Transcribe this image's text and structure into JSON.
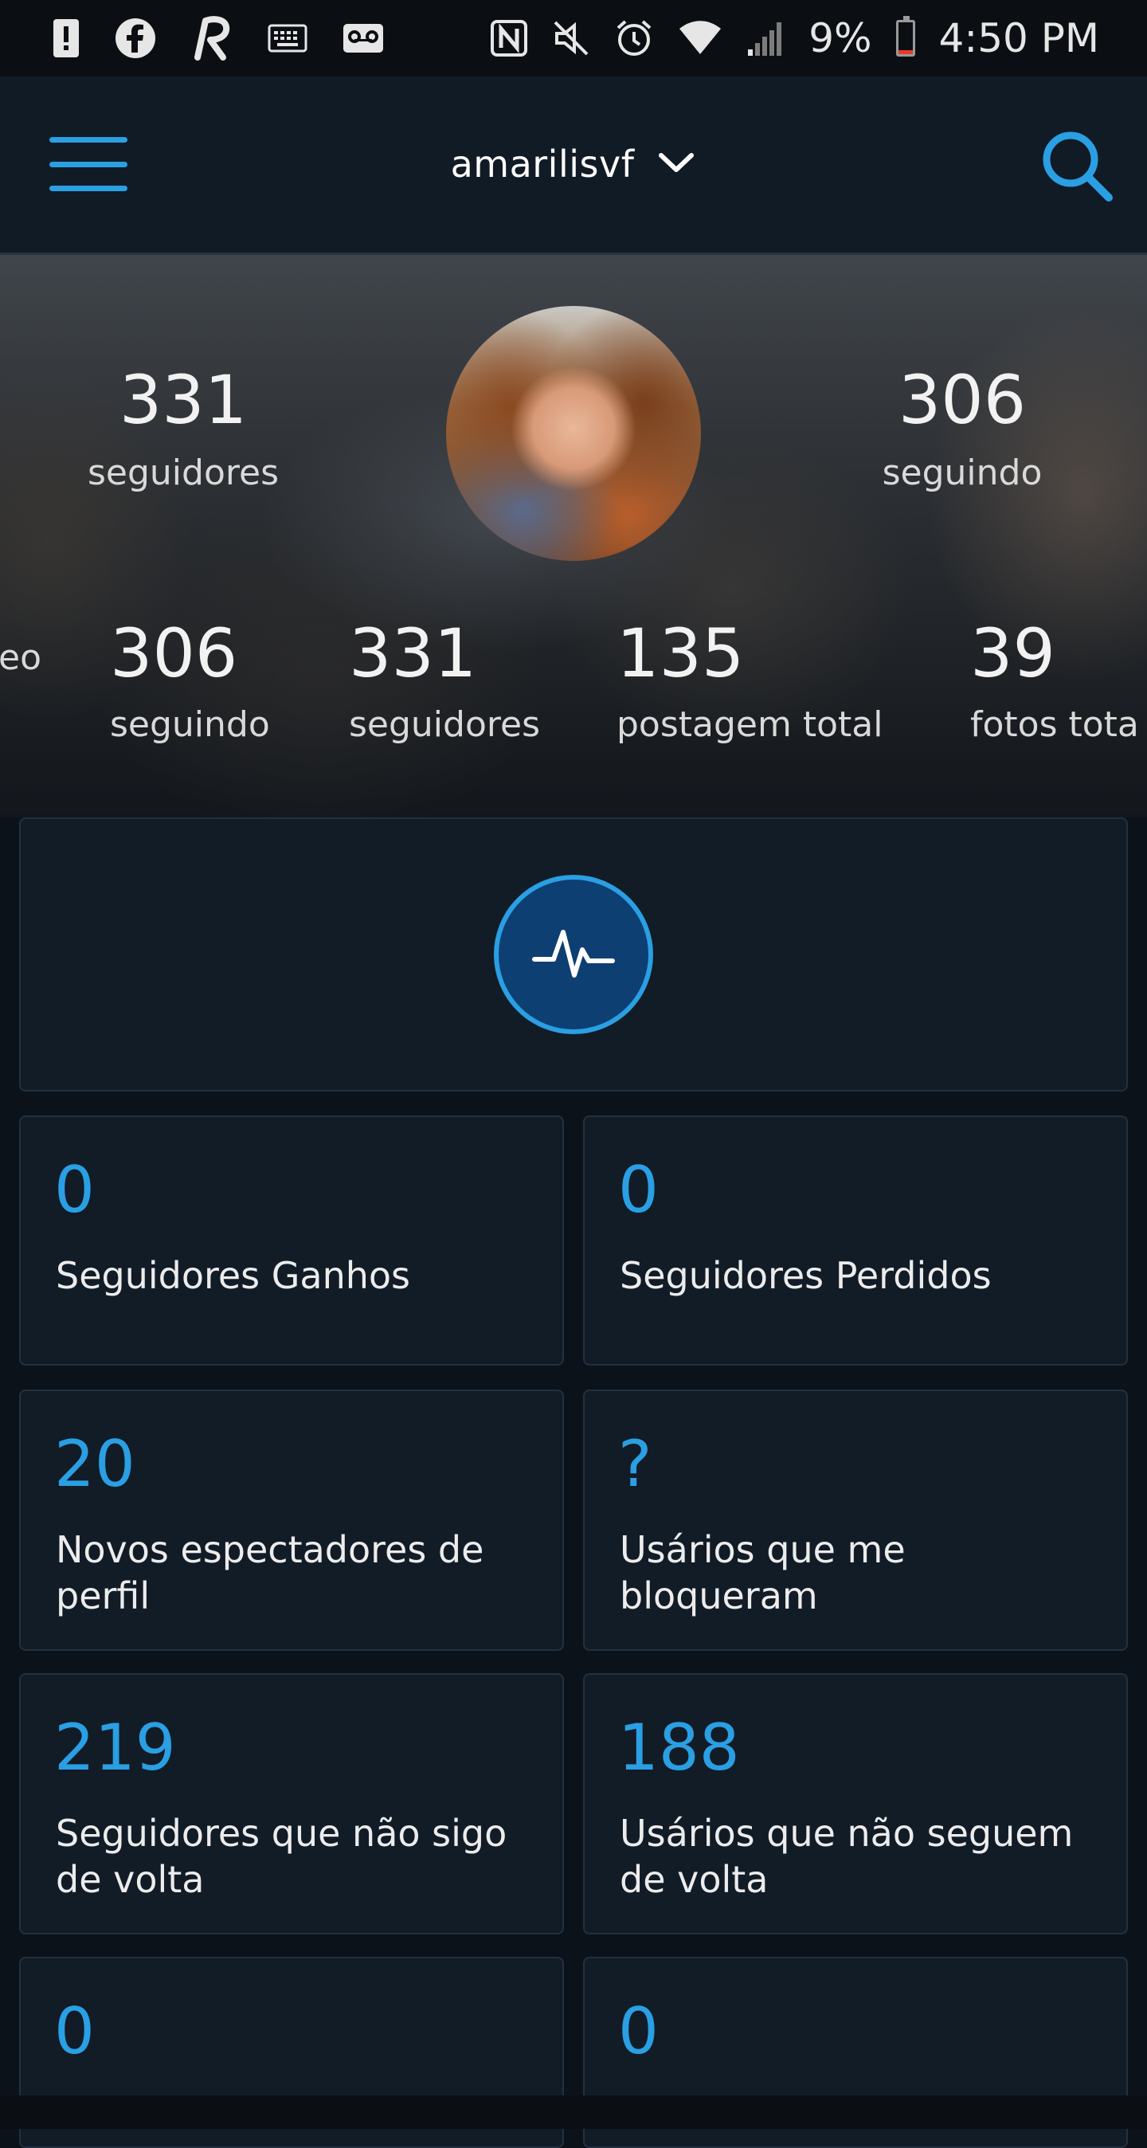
{
  "status_bar": {
    "battery_percent": "9%",
    "time": "4:50 PM",
    "battery_level": 0.09,
    "battery_fill_color": "#e53d2b",
    "left_icons": [
      "sim-alert-icon",
      "facebook-icon",
      "r-app-icon",
      "keyboard-icon",
      "voicemail-icon"
    ],
    "right_icons": [
      "nfc-icon",
      "mute-icon",
      "alarm-icon",
      "wifi-icon",
      "signal-icon",
      "battery-icon"
    ]
  },
  "header": {
    "account_name": "amarilisvf",
    "menu_icon": "hamburger-menu-icon",
    "dropdown_icon": "chevron-down-icon",
    "search_icon": "search-icon"
  },
  "profile": {
    "followers_count": "331",
    "followers_label": "seguidores",
    "following_count": "306",
    "following_label": "seguindo",
    "stats_row": [
      {
        "value": "",
        "label": "eo"
      },
      {
        "value": "306",
        "label": "seguindo"
      },
      {
        "value": "331",
        "label": "seguidores"
      },
      {
        "value": "135",
        "label": "postagem total"
      },
      {
        "value": "39",
        "label": "fotos tota"
      }
    ]
  },
  "activity": {
    "icon": "activity-pulse-icon"
  },
  "cards": [
    {
      "value": "0",
      "label": "Seguidores Ganhos"
    },
    {
      "value": "0",
      "label": "Seguidores Perdidos"
    },
    {
      "value": "20",
      "label": "Novos espectadores de perfil"
    },
    {
      "value": "?",
      "label": "Usários que me bloqueram"
    },
    {
      "value": "219",
      "label": "Seguidores que não sigo de volta"
    },
    {
      "value": "188",
      "label": "Usários que não seguem de volta"
    },
    {
      "value": "0",
      "label": ""
    },
    {
      "value": "0",
      "label": ""
    }
  ],
  "colors": {
    "accent": "#2a9fe3",
    "background": "#0c1219",
    "card": "#121c27",
    "header": "#111b26"
  }
}
